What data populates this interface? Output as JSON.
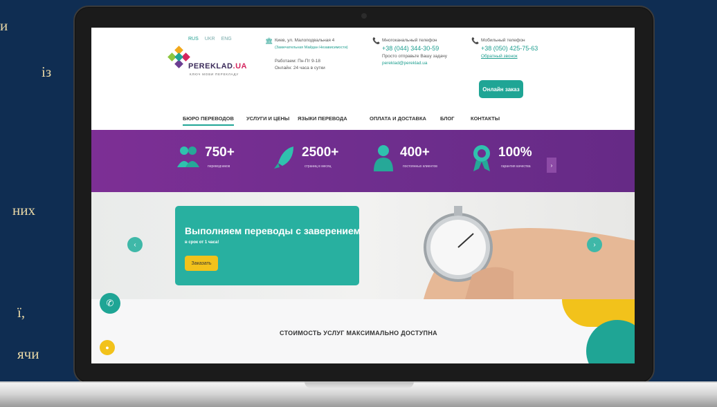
{
  "slide_fragments": [
    "и",
    "із",
    "них",
    "ї,",
    "ячи"
  ],
  "site": {
    "languages": [
      "RUS",
      "UKR",
      "ENG"
    ],
    "logo": {
      "name": "PEREKLAD",
      "tld": ".UA",
      "tagline": "КЛЮЧ МОВИ ПЕРЕКЛАДУ"
    },
    "address": {
      "line1": "Киев, ул. Малоподвальная 4",
      "line2": "(Замечательная Майдан Независимости)",
      "hours1": "Работаем: Пн-Пт 9-18",
      "hours2": "Онлайн: 24 часа в сутки"
    },
    "phone_city": {
      "label": "Многоканальный телефон",
      "number": "+38 (044) 344-30-59",
      "note": "Просто отправьте Вашу задачу",
      "email": "pereklad@pereklad.ua"
    },
    "phone_mobile": {
      "label": "Мобильный телефон",
      "number": "+38 (050) 425-75-63",
      "callback": "Обратный звонок"
    },
    "online_order": "Онлайн заказ",
    "nav": [
      "БЮРО ПЕРЕВОДОВ",
      "УСЛУГИ И ЦЕНЫ",
      "ЯЗЫКИ ПЕРЕВОДА",
      "ОПЛАТА И ДОСТАВКА",
      "БЛОГ",
      "КОНТАКТЫ"
    ],
    "stats": [
      {
        "value": "750+",
        "label": "переводчиков",
        "icon": "people-icon"
      },
      {
        "value": "2500+",
        "label": "страниц в месяц",
        "icon": "rocket-icon"
      },
      {
        "value": "400+",
        "label": "постоянных клиентов",
        "icon": "user-icon"
      },
      {
        "value": "100%",
        "label": "гарантия качества",
        "icon": "award-icon"
      }
    ],
    "stats_next": "›",
    "hero": {
      "title": "Выполняем переводы с заверением",
      "subtitle": "в срок от 1 часа!",
      "button": "Заказать",
      "prev": "‹",
      "next": "›"
    },
    "section_title": "СТОИМОСТЬ УСЛУГ МАКСИМАЛЬНО ДОСТУПНА"
  },
  "colors": {
    "teal": "#1fa595",
    "purple": "#6f2e8e",
    "yellow": "#f2c21b",
    "background": "#0f2d52",
    "slide_text": "#e9d8a6"
  }
}
